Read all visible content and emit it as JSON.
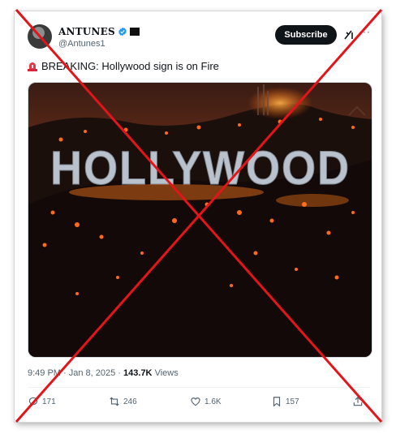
{
  "author": {
    "display_name": "ANTUNES",
    "handle": "@Antunes1"
  },
  "header": {
    "subscribe_label": "Subscribe",
    "more_label": "···"
  },
  "tweet": {
    "text": "BREAKING: Hollywood sign is on Fire"
  },
  "image": {
    "sign_text": "HOLLYWOOD"
  },
  "meta": {
    "time": "9:49 PM",
    "sep1": " · ",
    "date": "Jan 8, 2025",
    "sep2": " · ",
    "views_count": "143.7K",
    "views_label": " Views"
  },
  "actions": {
    "replies": "171",
    "reposts": "246",
    "likes": "1.6K",
    "bookmarks": "157"
  },
  "colors": {
    "overlay_x": "#e3151b",
    "verified": "#1d9bf0",
    "subscribe_bg": "#0f1419"
  },
  "icons": [
    "avatar",
    "verified-badge-icon",
    "flag-badge-icon",
    "grok-icon",
    "more-icon",
    "siren-icon",
    "reply-icon",
    "repost-icon",
    "like-icon",
    "bookmark-icon",
    "share-icon"
  ]
}
